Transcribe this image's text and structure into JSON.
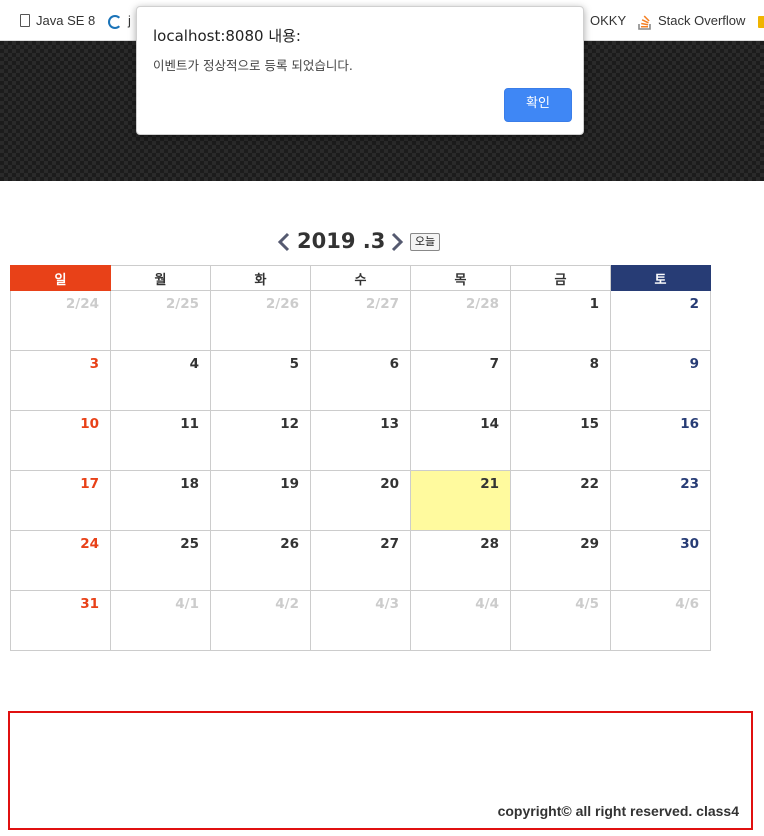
{
  "bookmarks": [
    {
      "label": "Java SE 8",
      "icon": "document-icon"
    },
    {
      "label": "j",
      "icon": "swirl-icon"
    },
    {
      "label": "OKKY",
      "icon": ""
    },
    {
      "label": "Stack Overflow",
      "icon": "stack-overflow-icon"
    }
  ],
  "dialog": {
    "title": "localhost:8080 내용:",
    "message": "이벤트가 정상적으로 등록 되었습니다.",
    "ok_label": "확인"
  },
  "calendar": {
    "title": "2019 .3",
    "today_label": "오늘",
    "weekdays": [
      "일",
      "월",
      "화",
      "수",
      "목",
      "금",
      "토"
    ],
    "weeks": [
      [
        {
          "label": "2/24",
          "current": false
        },
        {
          "label": "2/25",
          "current": false
        },
        {
          "label": "2/26",
          "current": false
        },
        {
          "label": "2/27",
          "current": false
        },
        {
          "label": "2/28",
          "current": false
        },
        {
          "label": "1",
          "current": true
        },
        {
          "label": "2",
          "current": true
        }
      ],
      [
        {
          "label": "3",
          "current": true
        },
        {
          "label": "4",
          "current": true
        },
        {
          "label": "5",
          "current": true
        },
        {
          "label": "6",
          "current": true
        },
        {
          "label": "7",
          "current": true
        },
        {
          "label": "8",
          "current": true
        },
        {
          "label": "9",
          "current": true
        }
      ],
      [
        {
          "label": "10",
          "current": true
        },
        {
          "label": "11",
          "current": true
        },
        {
          "label": "12",
          "current": true
        },
        {
          "label": "13",
          "current": true
        },
        {
          "label": "14",
          "current": true
        },
        {
          "label": "15",
          "current": true
        },
        {
          "label": "16",
          "current": true
        }
      ],
      [
        {
          "label": "17",
          "current": true
        },
        {
          "label": "18",
          "current": true
        },
        {
          "label": "19",
          "current": true
        },
        {
          "label": "20",
          "current": true
        },
        {
          "label": "21",
          "current": true,
          "today": true
        },
        {
          "label": "22",
          "current": true
        },
        {
          "label": "23",
          "current": true
        }
      ],
      [
        {
          "label": "24",
          "current": true
        },
        {
          "label": "25",
          "current": true
        },
        {
          "label": "26",
          "current": true
        },
        {
          "label": "27",
          "current": true
        },
        {
          "label": "28",
          "current": true
        },
        {
          "label": "29",
          "current": true
        },
        {
          "label": "30",
          "current": true
        }
      ],
      [
        {
          "label": "31",
          "current": true
        },
        {
          "label": "4/1",
          "current": false
        },
        {
          "label": "4/2",
          "current": false
        },
        {
          "label": "4/3",
          "current": false
        },
        {
          "label": "4/4",
          "current": false
        },
        {
          "label": "4/5",
          "current": false
        },
        {
          "label": "4/6",
          "current": false
        }
      ]
    ]
  },
  "footer": {
    "copyright": "copyright© all right reserved. class4"
  },
  "colors": {
    "sunday": "#e84118",
    "saturday": "#273c75",
    "today_highlight": "#fffa9e",
    "dialog_button": "#3f87f5",
    "footer_border": "#e01010"
  }
}
